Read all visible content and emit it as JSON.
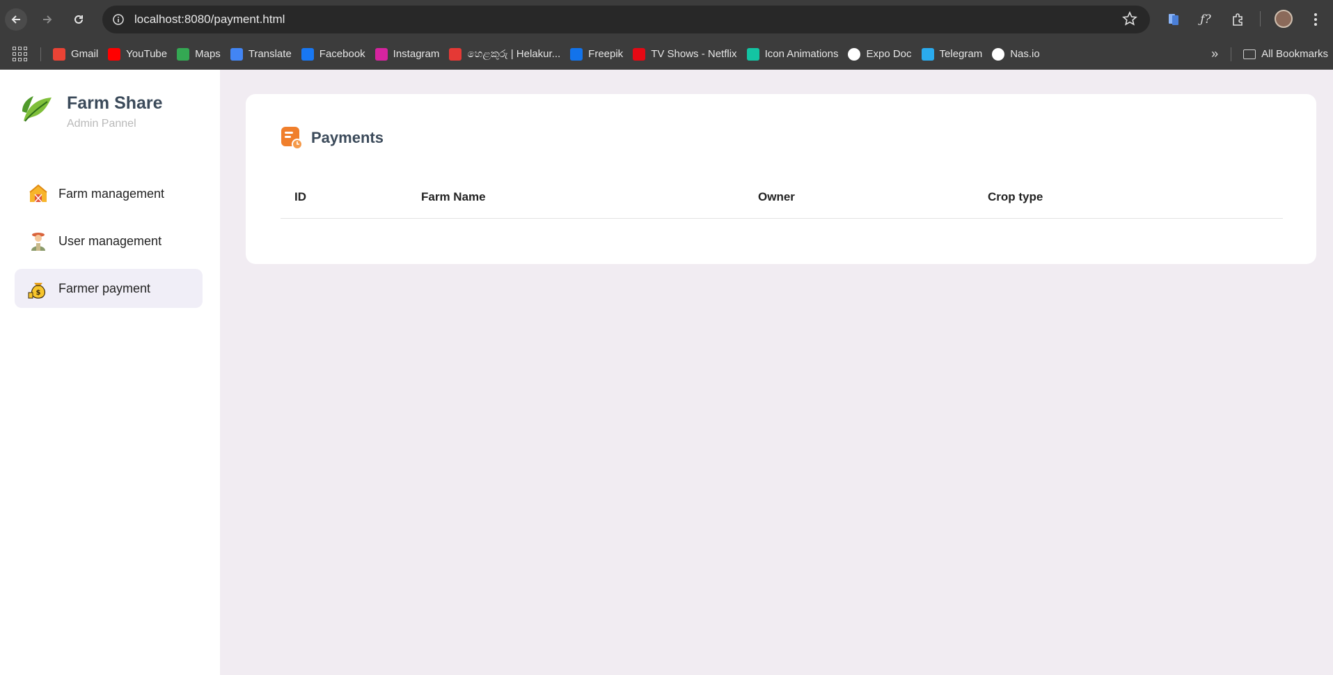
{
  "browser": {
    "url": "localhost:8080/payment.html",
    "bookmarks": [
      {
        "label": "Gmail",
        "icon": "gmail-icon",
        "color": "#ea4335"
      },
      {
        "label": "YouTube",
        "icon": "youtube-icon",
        "color": "#ff0000"
      },
      {
        "label": "Maps",
        "icon": "maps-icon",
        "color": "#34a853"
      },
      {
        "label": "Translate",
        "icon": "translate-icon",
        "color": "#4285f4"
      },
      {
        "label": "Facebook",
        "icon": "facebook-icon",
        "color": "#1877f2"
      },
      {
        "label": "Instagram",
        "icon": "instagram-icon",
        "color": "#d6249f"
      },
      {
        "label": "හෙළකුරු | Helakur...",
        "icon": "helakuru-icon",
        "color": "#e53935"
      },
      {
        "label": "Freepik",
        "icon": "freepik-icon",
        "color": "#1273eb"
      },
      {
        "label": "TV Shows - Netflix",
        "icon": "netflix-icon",
        "color": "#e50914"
      },
      {
        "label": "Icon Animations",
        "icon": "icon-animations-icon",
        "color": "#13c4a3"
      },
      {
        "label": "Expo Doc",
        "icon": "expo-icon",
        "color": "#ffffff"
      },
      {
        "label": "Telegram",
        "icon": "telegram-icon",
        "color": "#2aabee"
      },
      {
        "label": "Nas.io",
        "icon": "nasio-icon",
        "color": "#ffffff"
      }
    ],
    "all_bookmarks": "All Bookmarks"
  },
  "brand": {
    "title": "Farm Share",
    "subtitle": "Admin Pannel"
  },
  "sidebar": {
    "items": [
      {
        "label": "Farm management",
        "icon": "barn-icon",
        "active": false
      },
      {
        "label": "User management",
        "icon": "farmer-icon",
        "active": false
      },
      {
        "label": "Farmer payment",
        "icon": "money-bag-icon",
        "active": true
      }
    ]
  },
  "payments": {
    "title": "Payments",
    "columns": [
      "ID",
      "Farm Name",
      "Owner",
      "Crop type"
    ],
    "rows": []
  },
  "colors": {
    "page_bg": "#f1ecf2",
    "accent": "#f07f2c",
    "title_text": "#3b4a5a",
    "active_item_bg": "#f0eef7"
  }
}
